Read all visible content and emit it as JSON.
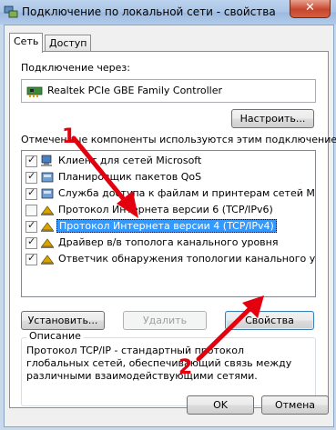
{
  "window": {
    "title": "Подключение по локальной сети - свойства",
    "close_symbol": "✕"
  },
  "tabs": [
    {
      "label": "Сеть",
      "active": true
    },
    {
      "label": "Доступ",
      "active": false
    }
  ],
  "connect_using": {
    "label": "Подключение через:",
    "adapter": "Realtek PCIe GBE Family Controller",
    "configure_button": "Настроить..."
  },
  "components": {
    "label": "Отмеченные компоненты используются этим подключением:",
    "items": [
      {
        "label": "Клиент для сетей Microsoft",
        "checked": true,
        "icon": "network-client-icon"
      },
      {
        "label": "Планировщик пакетов QoS",
        "checked": true,
        "icon": "network-service-icon"
      },
      {
        "label": "Служба доступа к файлам и принтерам сетей Micro...",
        "checked": true,
        "icon": "network-service-icon"
      },
      {
        "label": "Протокол Интернета версии 6 (TCP/IPv6)",
        "checked": false,
        "icon": "protocol-icon"
      },
      {
        "label": "Протокол Интернета версии 4 (TCP/IPv4)",
        "checked": true,
        "icon": "protocol-icon",
        "selected": true
      },
      {
        "label": "Драйвер в/в тополога канального уровня",
        "checked": true,
        "icon": "protocol-icon"
      },
      {
        "label": "Ответчик обнаружения топологии канального уровня",
        "checked": true,
        "icon": "protocol-icon"
      }
    ],
    "install_button": "Установить...",
    "uninstall_button": "Удалить",
    "properties_button": "Свойства"
  },
  "description": {
    "title": "Описание",
    "text": "Протокол TCP/IP - стандартный протокол глобальных сетей, обеспечивающий связь между различными взаимодействующими сетями."
  },
  "footer": {
    "ok_button": "OK",
    "cancel_button": "Отмена"
  },
  "annotations": {
    "marker1": "1",
    "marker2": "2",
    "color": "#e3000f"
  }
}
